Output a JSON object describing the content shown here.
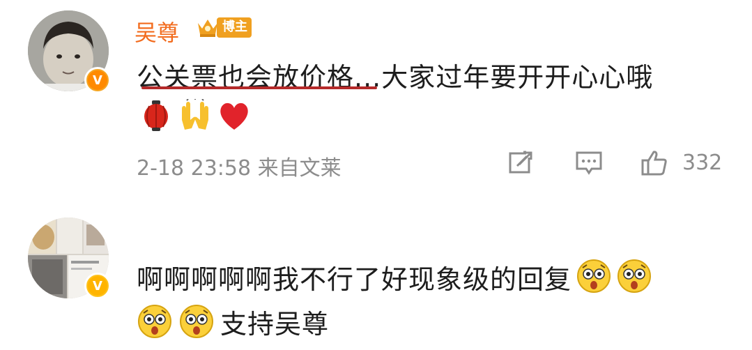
{
  "post": {
    "username": "吴尊",
    "badge_label": "博主",
    "comment_text": "公关票也会放价格...大家过年要开开心心哦",
    "emojis": [
      "lantern-emoji",
      "raised-hands-emoji",
      "red-heart-emoji"
    ],
    "meta": "2-18 23:58 来自文莱",
    "like_count": "332",
    "icons": {
      "share": "share-icon",
      "comment": "comment-icon",
      "like": "thumbs-up-icon"
    },
    "colors": {
      "username": "#f26b1d",
      "badge": "#f0a020",
      "underline": "#b52a2a",
      "meta": "#8c8c8c"
    }
  },
  "reply": {
    "text_line1": "啊啊啊啊啊我不行了好现象级的回复",
    "text_line2": "支持吴尊",
    "emojis": [
      "shocked-face-emoji",
      "shocked-face-emoji",
      "shocked-face-emoji",
      "shocked-face-emoji"
    ]
  }
}
